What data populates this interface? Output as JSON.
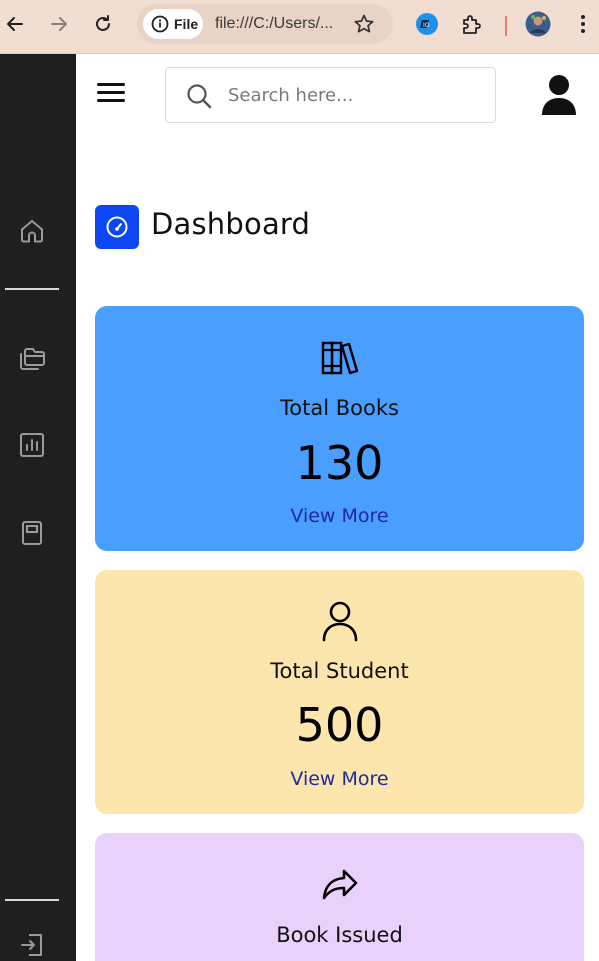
{
  "browser": {
    "site_chip_label": "File",
    "url": "file:///C:/Users/..."
  },
  "search": {
    "placeholder": "Search here..."
  },
  "dashboard": {
    "title": "Dashboard"
  },
  "cards": [
    {
      "label": "Total Books",
      "value": "130",
      "link": "View More",
      "color": "#4a9ffe"
    },
    {
      "label": "Total Student",
      "value": "500",
      "link": "View More",
      "color": "#fde6ad"
    },
    {
      "label": "Book Issued",
      "value": "",
      "link": "",
      "color": "#e8d1fb"
    }
  ],
  "icons": {
    "back": "arrow-left-icon",
    "forward": "arrow-right-icon",
    "reload": "reload-icon",
    "info": "info-icon",
    "bookmark": "star-icon",
    "extension_app": "app-icon",
    "extensions": "puzzle-icon",
    "profile": "profile-avatar",
    "browser_menu": "kebab-icon",
    "sidebar": [
      "home-icon",
      "files-icon",
      "chart-icon",
      "book-icon",
      "logout-icon"
    ],
    "menu": "hamburger-icon",
    "search": "search-icon",
    "user": "user-icon",
    "dashboard": "speedometer-icon",
    "cards": [
      "books-icon",
      "student-icon",
      "share-icon"
    ]
  },
  "colors": {
    "sidebar": "#1f1f1f",
    "dashboard_icon": "#0d47f5",
    "link": "#1d2a9e"
  }
}
